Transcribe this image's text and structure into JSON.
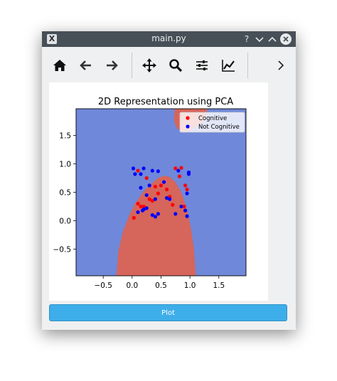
{
  "window": {
    "title": "main.py",
    "app_icon": "X",
    "buttons": {
      "help": "?",
      "minimize": "⌄",
      "maximize": "⌃",
      "close": "✕"
    }
  },
  "toolbar": {
    "tools": [
      {
        "name": "home-icon",
        "tooltip": "Home"
      },
      {
        "name": "back-arrow-icon",
        "tooltip": "Back"
      },
      {
        "name": "forward-arrow-icon",
        "tooltip": "Forward"
      },
      {
        "name": "pan-move-icon",
        "tooltip": "Pan"
      },
      {
        "name": "zoom-magnifier-icon",
        "tooltip": "Zoom"
      },
      {
        "name": "configure-subplots-icon",
        "tooltip": "Subplots"
      },
      {
        "name": "edit-axis-icon",
        "tooltip": "Customize"
      }
    ],
    "overflow": "›"
  },
  "plot_button": {
    "label": "Plot"
  },
  "colors": {
    "background_region": "#6f88d9",
    "cognitive_region": "#d6655b",
    "cognitive_points": "#ff0000",
    "not_cognitive_points": "#0000ff",
    "plot_button": "#3daee9"
  },
  "chart_data": {
    "type": "scatter",
    "title": "2D Representation using PCA",
    "xlabel": "",
    "ylabel": "",
    "xlim": [
      -0.97,
      1.97
    ],
    "ylim": [
      -0.97,
      1.97
    ],
    "xticks": [
      -0.5,
      0.0,
      0.5,
      1.0,
      1.5
    ],
    "xtick_labels": [
      "−0.5",
      "0.0",
      "0.5",
      "1.0",
      "1.5"
    ],
    "yticks": [
      -0.5,
      0.0,
      0.5,
      1.0,
      1.5
    ],
    "ytick_labels": [
      "−0.5",
      "0.0",
      "0.5",
      "1.0",
      "1.5"
    ],
    "legend": {
      "position": "upper-right",
      "entries": [
        "Cognitive",
        "Not Cognitive"
      ]
    },
    "decision_regions": [
      {
        "class": "Cognitive",
        "description": "lower parabolic region",
        "boundary": [
          [
            -0.27,
            -0.97
          ],
          [
            -0.24,
            -0.55
          ],
          [
            -0.16,
            -0.2
          ],
          [
            -0.05,
            0.1
          ],
          [
            0.05,
            0.3
          ],
          [
            0.2,
            0.52
          ],
          [
            0.33,
            0.65
          ],
          [
            0.45,
            0.75
          ],
          [
            0.55,
            0.79
          ],
          [
            0.65,
            0.77
          ],
          [
            0.75,
            0.68
          ],
          [
            0.85,
            0.5
          ],
          [
            0.95,
            0.2
          ],
          [
            1.02,
            -0.15
          ],
          [
            1.07,
            -0.5
          ],
          [
            1.1,
            -0.97
          ]
        ]
      },
      {
        "class": "Cognitive",
        "description": "upper right region",
        "boundary": [
          [
            0.74,
            1.97
          ],
          [
            0.72,
            1.8
          ],
          [
            0.75,
            1.68
          ],
          [
            0.8,
            1.6
          ],
          [
            0.9,
            1.57
          ],
          [
            1.0,
            1.59
          ],
          [
            1.1,
            1.65
          ],
          [
            1.2,
            1.72
          ],
          [
            1.28,
            1.82
          ],
          [
            1.3,
            1.97
          ]
        ]
      }
    ],
    "series": [
      {
        "name": "Cognitive",
        "color": "#ff0000",
        "points": [
          [
            0.03,
            0.05
          ],
          [
            0.1,
            0.3
          ],
          [
            0.1,
            0.88
          ],
          [
            0.15,
            0.25
          ],
          [
            0.2,
            0.25
          ],
          [
            0.3,
            0.38
          ],
          [
            0.35,
            0.35
          ],
          [
            0.4,
            0.6
          ],
          [
            0.45,
            0.48
          ],
          [
            0.5,
            0.62
          ],
          [
            0.6,
            0.55
          ],
          [
            0.65,
            0.42
          ],
          [
            0.7,
            0.28
          ],
          [
            0.75,
            0.92
          ],
          [
            0.82,
            0.78
          ],
          [
            0.85,
            0.93
          ],
          [
            0.9,
            0.25
          ],
          [
            0.92,
            0.62
          ],
          [
            0.95,
            0.55
          ],
          [
            0.25,
            0.75
          ]
        ]
      },
      {
        "name": "Not Cognitive",
        "color": "#0000ff",
        "points": [
          [
            0.02,
            0.92
          ],
          [
            0.05,
            0.82
          ],
          [
            0.1,
            0.15
          ],
          [
            0.15,
            0.82
          ],
          [
            0.2,
            0.92
          ],
          [
            0.2,
            0.2
          ],
          [
            0.25,
            0.45
          ],
          [
            0.25,
            0.22
          ],
          [
            0.3,
            0.62
          ],
          [
            0.35,
            0.88
          ],
          [
            0.35,
            0.1
          ],
          [
            0.4,
            0.07
          ],
          [
            0.4,
            0.38
          ],
          [
            0.45,
            0.12
          ],
          [
            0.45,
            0.87
          ],
          [
            0.55,
            0.68
          ],
          [
            0.6,
            0.4
          ],
          [
            0.65,
            0.38
          ],
          [
            0.75,
            0.12
          ],
          [
            0.8,
            0.88
          ],
          [
            0.85,
            0.25
          ],
          [
            0.92,
            0.18
          ],
          [
            0.95,
            0.08
          ],
          [
            0.95,
            0.48
          ],
          [
            0.98,
            0.85
          ],
          [
            0.98,
            0.82
          ],
          [
            0.15,
            0.58
          ],
          [
            0.18,
            0.18
          ]
        ]
      }
    ]
  }
}
